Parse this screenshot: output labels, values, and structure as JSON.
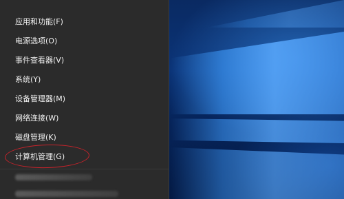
{
  "menu": {
    "items": [
      {
        "label": "应用和功能(F)"
      },
      {
        "label": "电源选项(O)"
      },
      {
        "label": "事件查看器(V)"
      },
      {
        "label": "系统(Y)"
      },
      {
        "label": "设备管理器(M)"
      },
      {
        "label": "网络连接(W)"
      },
      {
        "label": "磁盘管理(K)"
      },
      {
        "label": "计算机管理(G)"
      }
    ]
  },
  "annotation": {
    "highlighted_item": "计算机管理(G)",
    "color": "#c8232b"
  },
  "colors": {
    "menu_background": "#2b2b2b",
    "menu_text": "#f2f2f2",
    "desktop_blue": "#0b3478"
  }
}
